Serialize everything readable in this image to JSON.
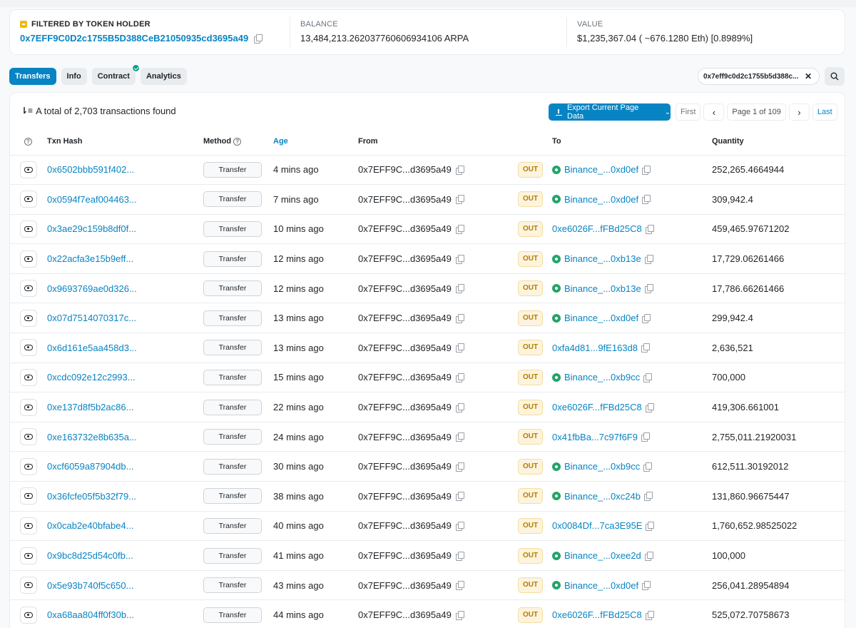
{
  "summary": {
    "filter_label": "FILTERED BY TOKEN HOLDER",
    "holder_address": "0x7EFF9C0D2c1755B5D388CeB21050935cd3695a49",
    "balance_label": "BALANCE",
    "balance_value": "13,484,213.262037760606934106 ARPA",
    "value_label": "VALUE",
    "value_value": "$1,235,367.04 ( ~676.1280 Eth) [0.8989%]"
  },
  "tabs": [
    "Transfers",
    "Info",
    "Contract",
    "Analytics"
  ],
  "filter_chip": "0x7eff9c0d2c1755b5d388c...",
  "list": {
    "total_text": "A total of 2,703 transactions found",
    "export_label": "Export Current Page Data",
    "pager": {
      "first": "First",
      "info": "Page 1 of 109",
      "last": "Last"
    }
  },
  "columns": {
    "txn_hash": "Txn Hash",
    "method": "Method",
    "age": "Age",
    "from": "From",
    "to": "To",
    "quantity": "Quantity"
  },
  "colors": {
    "accent": "#0784c3",
    "out_badge": "#b47d00",
    "verified": "#00a186"
  },
  "rows": [
    {
      "hash": "0x6502bbb591f402...",
      "method": "Transfer",
      "age": "4 mins ago",
      "from": "0x7EFF9C...d3695a49",
      "dir": "OUT",
      "to": "Binance_...0xd0ef",
      "to_labeled": true,
      "qty": "252,265.4664944"
    },
    {
      "hash": "0x0594f7eaf004463...",
      "method": "Transfer",
      "age": "7 mins ago",
      "from": "0x7EFF9C...d3695a49",
      "dir": "OUT",
      "to": "Binance_...0xd0ef",
      "to_labeled": true,
      "qty": "309,942.4"
    },
    {
      "hash": "0x3ae29c159b8df0f...",
      "method": "Transfer",
      "age": "10 mins ago",
      "from": "0x7EFF9C...d3695a49",
      "dir": "OUT",
      "to": "0xe6026F...fFBd25C8",
      "to_labeled": false,
      "qty": "459,465.97671202"
    },
    {
      "hash": "0x22acfa3e15b9eff...",
      "method": "Transfer",
      "age": "12 mins ago",
      "from": "0x7EFF9C...d3695a49",
      "dir": "OUT",
      "to": "Binance_...0xb13e",
      "to_labeled": true,
      "qty": "17,729.06261466"
    },
    {
      "hash": "0x9693769ae0d326...",
      "method": "Transfer",
      "age": "12 mins ago",
      "from": "0x7EFF9C...d3695a49",
      "dir": "OUT",
      "to": "Binance_...0xb13e",
      "to_labeled": true,
      "qty": "17,786.66261466"
    },
    {
      "hash": "0x07d7514070317c...",
      "method": "Transfer",
      "age": "13 mins ago",
      "from": "0x7EFF9C...d3695a49",
      "dir": "OUT",
      "to": "Binance_...0xd0ef",
      "to_labeled": true,
      "qty": "299,942.4"
    },
    {
      "hash": "0x6d161e5aa458d3...",
      "method": "Transfer",
      "age": "13 mins ago",
      "from": "0x7EFF9C...d3695a49",
      "dir": "OUT",
      "to": "0xfa4d81...9fE163d8",
      "to_labeled": false,
      "qty": "2,636,521"
    },
    {
      "hash": "0xcdc092e12c2993...",
      "method": "Transfer",
      "age": "15 mins ago",
      "from": "0x7EFF9C...d3695a49",
      "dir": "OUT",
      "to": "Binance_...0xb9cc",
      "to_labeled": true,
      "qty": "700,000"
    },
    {
      "hash": "0xe137d8f5b2ac86...",
      "method": "Transfer",
      "age": "22 mins ago",
      "from": "0x7EFF9C...d3695a49",
      "dir": "OUT",
      "to": "0xe6026F...fFBd25C8",
      "to_labeled": false,
      "qty": "419,306.661001"
    },
    {
      "hash": "0xe163732e8b635a...",
      "method": "Transfer",
      "age": "24 mins ago",
      "from": "0x7EFF9C...d3695a49",
      "dir": "OUT",
      "to": "0x41fbBa...7c97f6F9",
      "to_labeled": false,
      "qty": "2,755,011.21920031"
    },
    {
      "hash": "0xcf6059a87904db...",
      "method": "Transfer",
      "age": "30 mins ago",
      "from": "0x7EFF9C...d3695a49",
      "dir": "OUT",
      "to": "Binance_...0xb9cc",
      "to_labeled": true,
      "qty": "612,511.30192012"
    },
    {
      "hash": "0x36fcfe05f5b32f79...",
      "method": "Transfer",
      "age": "38 mins ago",
      "from": "0x7EFF9C...d3695a49",
      "dir": "OUT",
      "to": "Binance_...0xc24b",
      "to_labeled": true,
      "qty": "131,860.96675447"
    },
    {
      "hash": "0x0cab2e40bfabe4...",
      "method": "Transfer",
      "age": "40 mins ago",
      "from": "0x7EFF9C...d3695a49",
      "dir": "OUT",
      "to": "0x0084Df...7ca3E95E",
      "to_labeled": false,
      "qty": "1,760,652.98525022"
    },
    {
      "hash": "0x9bc8d25d54c0fb...",
      "method": "Transfer",
      "age": "41 mins ago",
      "from": "0x7EFF9C...d3695a49",
      "dir": "OUT",
      "to": "Binance_...0xee2d",
      "to_labeled": true,
      "qty": "100,000"
    },
    {
      "hash": "0x5e93b740f5c650...",
      "method": "Transfer",
      "age": "43 mins ago",
      "from": "0x7EFF9C...d3695a49",
      "dir": "OUT",
      "to": "Binance_...0xd0ef",
      "to_labeled": true,
      "qty": "256,041.28954894"
    },
    {
      "hash": "0xa68aa804ff0f30b...",
      "method": "Transfer",
      "age": "44 mins ago",
      "from": "0x7EFF9C...d3695a49",
      "dir": "OUT",
      "to": "0xe6026F...fFBd25C8",
      "to_labeled": false,
      "qty": "525,072.70758673"
    }
  ]
}
